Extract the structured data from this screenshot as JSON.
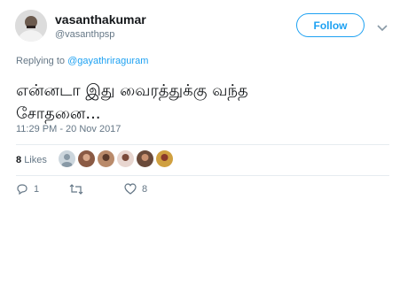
{
  "author": {
    "name": "vasanthakumar",
    "handle": "@vasanthpsp"
  },
  "follow_label": "Follow",
  "reply": {
    "prefix": "Replying to ",
    "to": "@gayathriraguram"
  },
  "tweet": {
    "line1": "என்னடா இது வைரத்துக்கு வந்த",
    "line2": "சோதனை..."
  },
  "timestamp": "11:29 PM - 20 Nov 2017",
  "likes": {
    "count": "8",
    "label": "Likes"
  },
  "actions": {
    "reply_count": "1",
    "retweet_count": "",
    "like_count": "8"
  },
  "colors": {
    "accent": "#1da1f2",
    "secondary_text": "#657786",
    "divider": "#e6ecf0"
  }
}
